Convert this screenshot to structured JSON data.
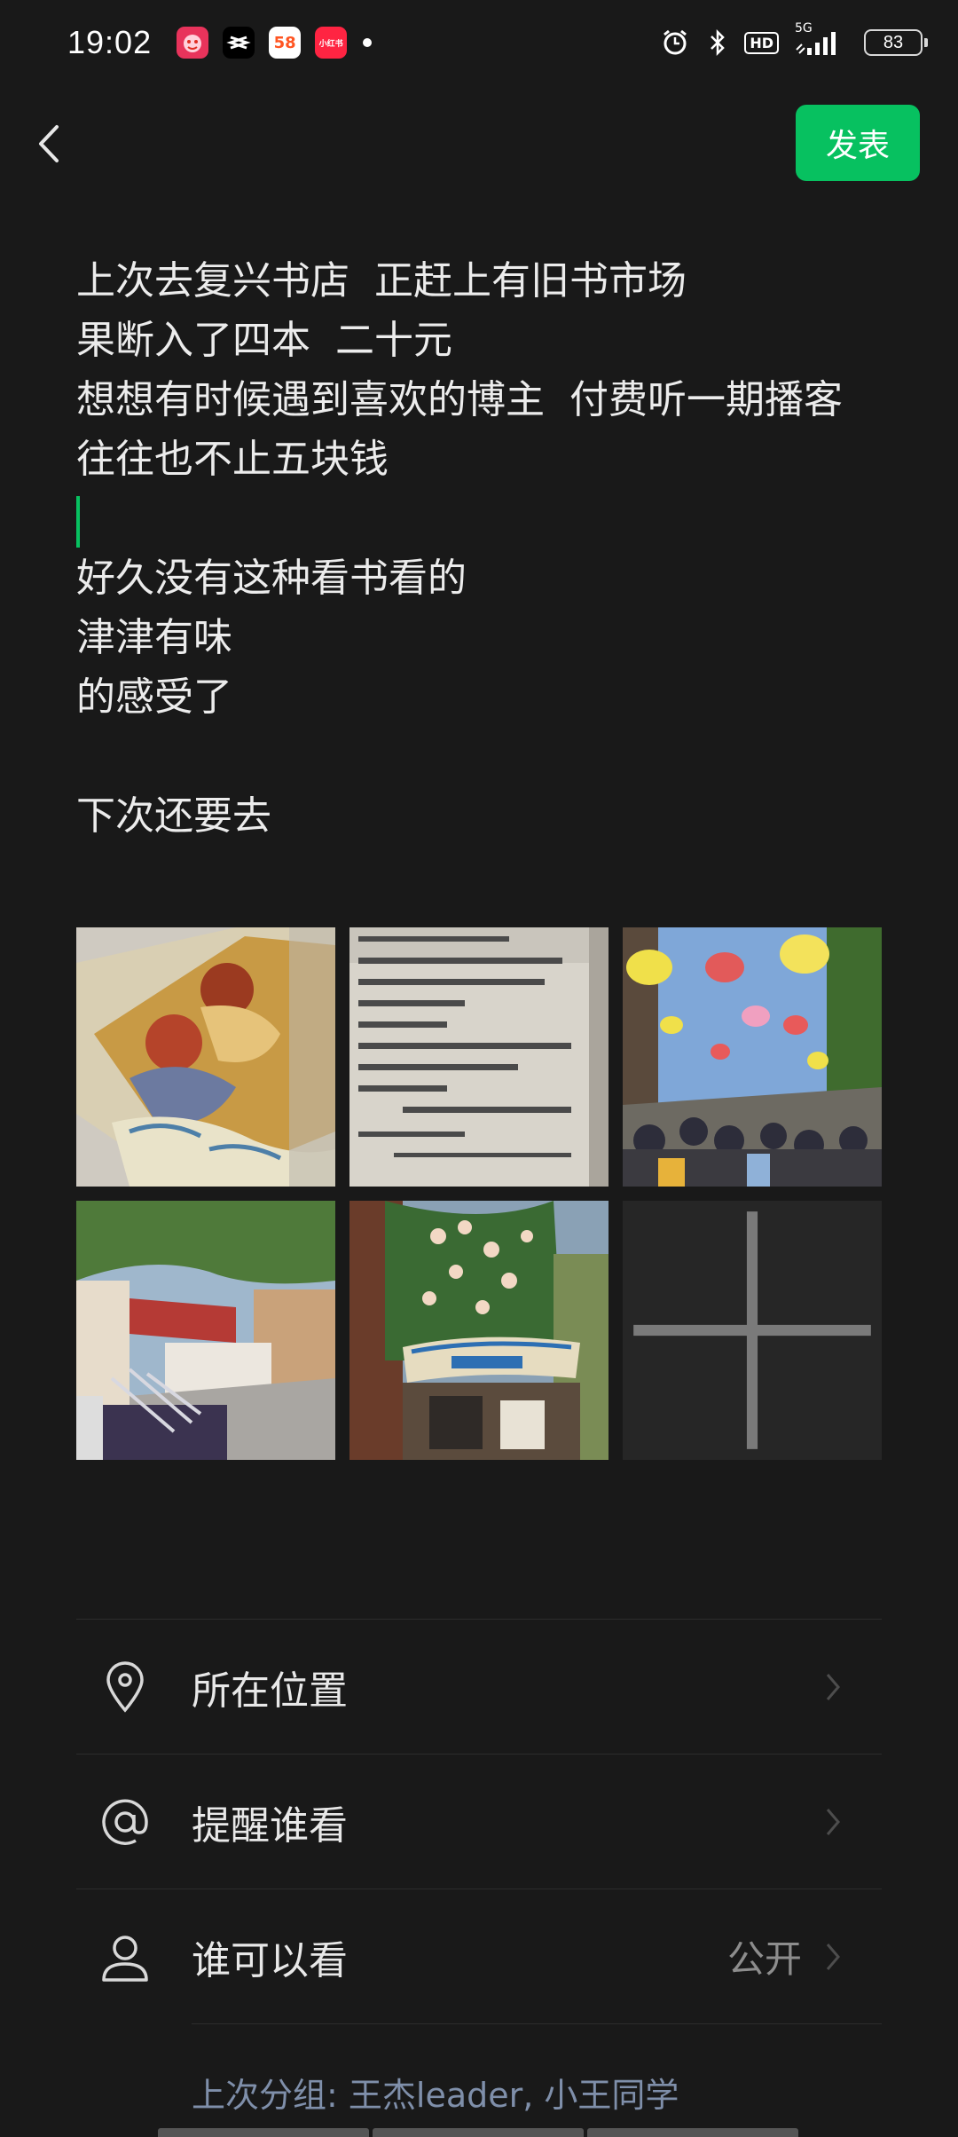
{
  "status_bar": {
    "time": "19:02",
    "app_icons": [
      {
        "name": "pinduoduo-icon",
        "label": "",
        "color": "#e02e24"
      },
      {
        "name": "capcut-icon",
        "label": "",
        "color": "#000000"
      },
      {
        "name": "58-tongcheng-icon",
        "label": "58",
        "color": "#ffffff"
      },
      {
        "name": "xiaohongshu-icon",
        "label": "小红书",
        "color": "#ff2442"
      }
    ],
    "network": "5G",
    "hd": "HD",
    "battery": "83"
  },
  "nav": {
    "publish_label": "发表"
  },
  "post": {
    "lines": [
      "上次去复兴书店  正赶上有旧书市场",
      "果断入了四本  二十元",
      "想想有时候遇到喜欢的博主  付费听一期播客",
      "往往也不止五块钱",
      "",
      "好久没有这种看书看的",
      "津津有味",
      "的感受了",
      "",
      "下次还要去"
    ]
  },
  "images": [
    {
      "name": "photo-illustration-book"
    },
    {
      "name": "photo-book-copyright-page"
    },
    {
      "name": "photo-lantern-street"
    },
    {
      "name": "photo-book-market-street"
    },
    {
      "name": "photo-old-bookstore-sign"
    }
  ],
  "options": {
    "location_label": "所在位置",
    "mention_label": "提醒谁看",
    "visibility_label": "谁可以看",
    "visibility_value": "公开"
  },
  "last_group": "上次分组: 王杰leader, 小王同学",
  "colors": {
    "accent": "#07c160",
    "background": "#191919"
  }
}
